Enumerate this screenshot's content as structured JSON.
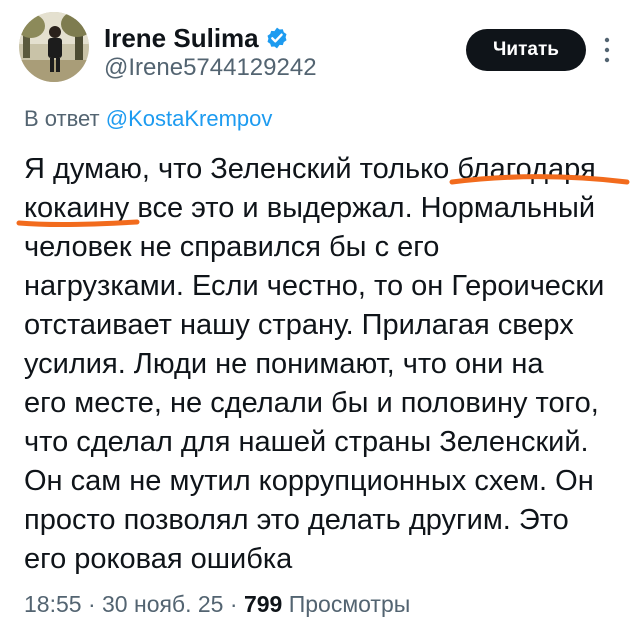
{
  "author": {
    "display_name": "Irene Sulima",
    "handle": "@Irene5744129242",
    "verified_color": "#1d9bf0"
  },
  "follow_button": {
    "label": "Читать"
  },
  "reply_context": {
    "prefix": "В ответ",
    "mention": "@KostaKrempov"
  },
  "tweet": {
    "lines": [
      "Я думаю, что Зеленский только благодаря",
      "кокаину все это и выдержал. Нормальный",
      "человек не справился бы с его",
      "нагрузками. Если честно, то он Героически",
      "отстаивает нашу страну. Прилагая сверх",
      "усилия. Люди не понимают, что они на",
      "его месте, не сделали бы и половину того,",
      "что сделал для нашей страны Зеленский.",
      "Он сам не мутил коррупционных схем. Он",
      "просто позволял это делать другим. Это",
      "его роковая ошибка"
    ],
    "highlight_color": "#f26b1d"
  },
  "meta": {
    "time": "18:55",
    "separator": "·",
    "date": "30 нояб. 25",
    "views_count": "799",
    "views_label": "Просмотры"
  },
  "colors": {
    "text": "#0f1419",
    "secondary": "#536471",
    "link": "#1d9bf0",
    "button_bg": "#0f1419"
  }
}
